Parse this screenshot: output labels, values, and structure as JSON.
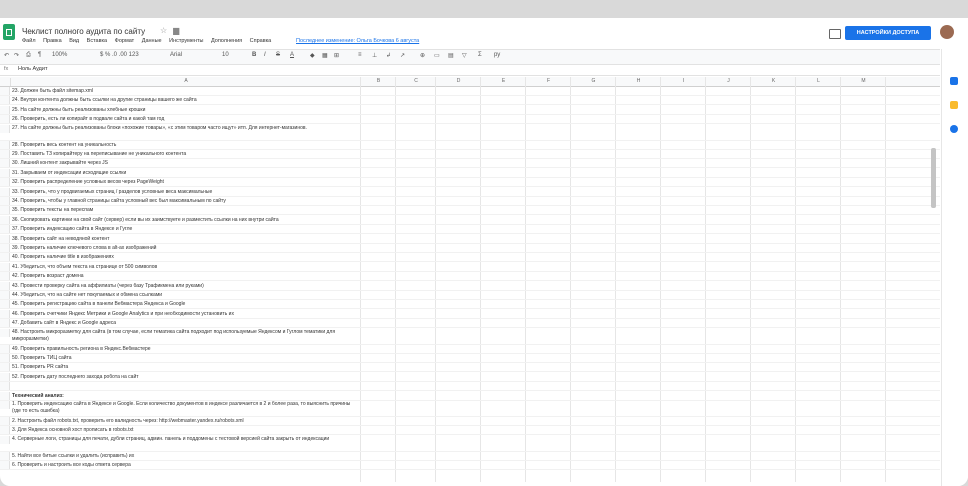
{
  "doc": {
    "title": "Чеклист полного аудита по сайту",
    "last_edit": "Последнее изменение: Ольга Бочкова 6 августа"
  },
  "menu": [
    "Файл",
    "Правка",
    "Вид",
    "Вставка",
    "Формат",
    "Данные",
    "Инструменты",
    "Дополнения",
    "Справка"
  ],
  "share_label": "НАСТРОЙКИ ДОСТУПА",
  "toolbar": {
    "zoom": "100%",
    "font": "Arial",
    "size": "10"
  },
  "formula": {
    "fx": "fx",
    "value": "Ноль Аудит"
  },
  "columns": [
    "A",
    "B",
    "C",
    "D",
    "E",
    "F",
    "G",
    "H",
    "I",
    "J",
    "K",
    "L",
    "M"
  ],
  "rows": [
    "23. Должен быть файл sitemap.xml",
    "24. Внутри контента должны быть ссылки на другие страницы вашего же сайта",
    "25. На сайте должны быть реализованы хлебные крошки",
    "26. Проверить, есть ли копирайт в подвале сайта и какой там год",
    "27. На сайте должны быть реализованы блоки «похожие товары», «с этим товаром часто ищут» итп. Для интернет-магазинов.",
    "28. Проверить весь контент на уникальность",
    "29. Поставить ТЗ копирайтеру на переписывание не уникального контента",
    "30. Лишний контент закрывайте через JS",
    "31. Закрываем от индексации исходящие ссылки",
    "32. Проверить распределение условных весов через PageWeight",
    "33. Проверить, что у продвигаемых страниц / разделов условные веса максимальные",
    "34. Проверить, чтобы у главной страницы сайта условный вес был максимальным по сайту",
    "35. Проверить тексты на переспам",
    "36. Скопировать картинки на свой сайт (сервер) если вы их заимствуете и разместить ссылки на них внутри сайта",
    "37. Проверить индексацию сайта в Яндексе и Гугле",
    "38. Проверить сайт на неводяной контент",
    "39. Проверить наличие ключевого слова в alt-ах изображений",
    "40. Проверить наличие title в изображениях",
    "41. Убедиться, что объем текста на странице от 500 символов",
    "42. Проверить возраст домена",
    "43. Провести проверку сайта на аффилиаты (через базу Трафикмена или руками)",
    "44. Убедиться, что на сайте нет покупаемых и обмена ссылками",
    "45. Проверить регистрацию сайта в панели Вебмастера Яндекса и Google",
    "46. Проверить счетчики Яндекс Метрики и Google Analytics и при необходимости установить их",
    "47. Добавить сайт в Яндекс и Google адреса",
    "48. Настроить микроразметку для сайта (в том случае, если тематика сайта подходит под используемые Яндексом и Гуглом тематики для микроразметки)",
    "49. Проверить правильность региона в Яндекс.Вебмастере",
    "50. Проверить ТИЦ сайта",
    "51. Проверить PR сайта",
    "52. Проверить дату последнего захода робота на сайт",
    "",
    "Технический анализ:",
    "1. Проверить индексацию сайта в Яндексе и Google. Если количество документов в индексе различается в 2 и более раза, то выяснить причины (где то есть ошибка)",
    "2. Настроить файл robots.txt, проверить его валидность через: http://webmaster.yandex.ru/robots.xml",
    "3. Для Яндекса основной хост прописать в robots.txt",
    "4. Серверные логи, страницы для печати, дубли страниц, админ. панель и поддомены с тестовой версией сайта закрыть от индексации",
    "5. Найти все битые ссылки и удалить (исправить) их",
    "6. Проверить и настроить все коды ответа сервера"
  ]
}
